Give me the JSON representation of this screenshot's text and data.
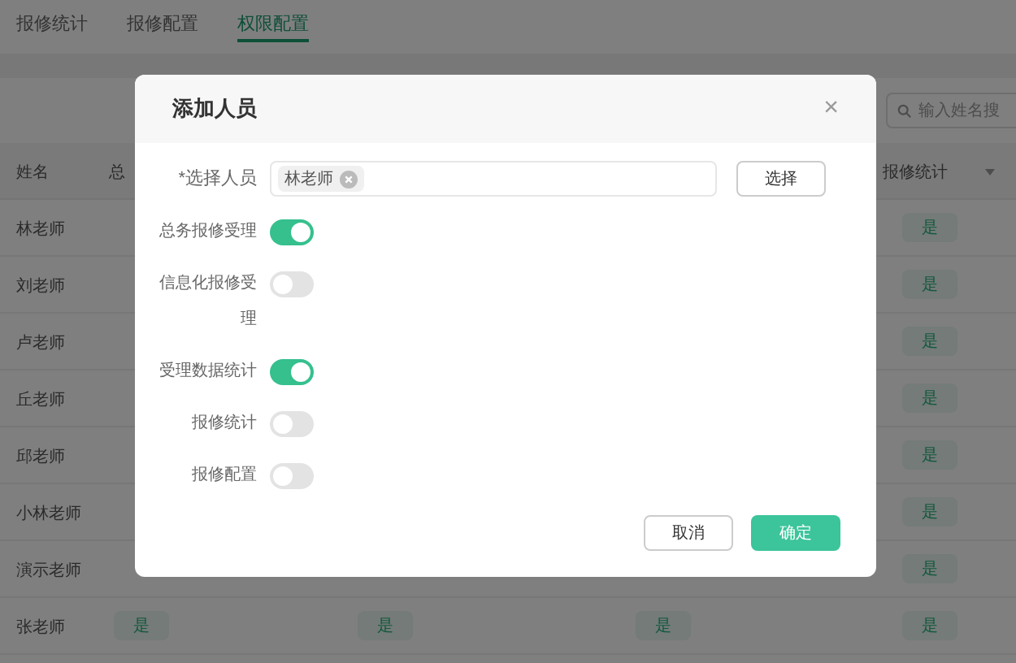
{
  "tabs": [
    {
      "label": "报修统计",
      "selected": false
    },
    {
      "label": "报修配置",
      "selected": false
    },
    {
      "label": "权限配置",
      "selected": true
    }
  ],
  "search": {
    "placeholder": "输入姓名搜"
  },
  "table": {
    "columns": [
      "姓名",
      "总",
      "",
      "",
      "报修统计"
    ],
    "rows": [
      {
        "cells": [
          "林老师",
          "",
          "",
          "",
          "是"
        ]
      },
      {
        "cells": [
          "刘老师",
          "",
          "",
          "",
          "是"
        ]
      },
      {
        "cells": [
          "卢老师",
          "",
          "",
          "",
          "是"
        ]
      },
      {
        "cells": [
          "丘老师",
          "",
          "",
          "",
          "是"
        ]
      },
      {
        "cells": [
          "邱老师",
          "",
          "",
          "",
          "是"
        ]
      },
      {
        "cells": [
          "小林老师",
          "",
          "",
          "",
          "是"
        ]
      },
      {
        "cells": [
          "演示老师",
          "",
          "",
          "",
          "是"
        ]
      },
      {
        "cells": [
          "张老师",
          "是",
          "是",
          "是",
          "是"
        ]
      }
    ]
  },
  "dialog": {
    "title": "添加人员",
    "close": "×",
    "person_label": "*选择人员",
    "person_tag": "林老师",
    "choose_button": "选择",
    "switches": [
      {
        "label": "总务报修受理",
        "on": true
      },
      {
        "label": "信息化报修受理",
        "on": false
      },
      {
        "label": "受理数据统计",
        "on": true
      },
      {
        "label": "报修统计",
        "on": false
      },
      {
        "label": "报修配置",
        "on": false
      }
    ],
    "buttons": [
      {
        "label": "取消",
        "kind": "secondary"
      },
      {
        "label": "确定",
        "kind": "primary"
      }
    ]
  }
}
